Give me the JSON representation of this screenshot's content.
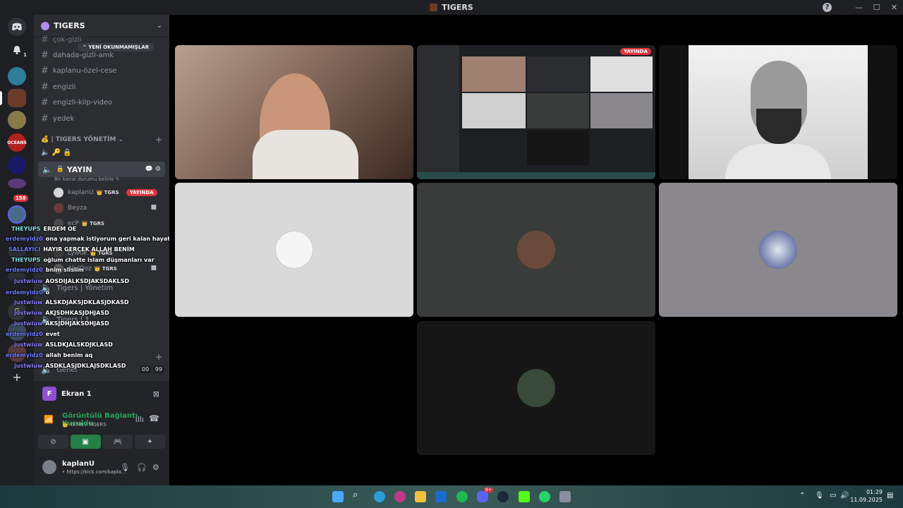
{
  "window": {
    "title": "TIGERS",
    "help_label": "?",
    "minimize": "—",
    "maximize": "☐",
    "close": "✕"
  },
  "servers": {
    "items": [
      {
        "name": "discord-home",
        "color": "#5865f2"
      },
      {
        "name": "notifications",
        "color": "#313338"
      },
      {
        "name": "server-1",
        "color": "#2e7d9a"
      },
      {
        "name": "server-tigers",
        "color": "#6b3a2a"
      },
      {
        "name": "server-3",
        "color": "#8a7a4a"
      },
      {
        "name": "server-oceans",
        "color": "#b32020"
      },
      {
        "name": "server-5",
        "color": "#1a1a6a"
      },
      {
        "name": "server-6",
        "color": "#5a3a7a"
      },
      {
        "name": "server-7",
        "color": "#4a6a8a"
      }
    ],
    "badge_count": "158",
    "notif_count": "1"
  },
  "sidebar": {
    "guild_name": "TIGERS",
    "unread_pill": "YENİ OKUNMAMIŞLAR",
    "channels": [
      "çok-gizli",
      "dahada-gizli-amk",
      "kaplanu-özel-cese",
      "engizli",
      "engizli-kilp-video",
      "yedek"
    ],
    "category": "| TIGERS YÖNETİM",
    "voice_channel": "YAYIN",
    "voice_sub": "Bir kanal durumu belirle",
    "voice_users": [
      {
        "name": "kaplanU",
        "tag": "TGRS",
        "live": "YAYINDA"
      },
      {
        "name": "Beyza",
        "tag": "",
        "live": ""
      },
      {
        "name": "ecP",
        "tag": "TGRS",
        "live": ""
      },
      {
        "name": "Lywok",
        "tag": "TGRS",
        "live": ""
      },
      {
        "name": "AkılOoz",
        "tag": "TGRS",
        "live": ""
      }
    ],
    "lower_items": [
      "Tigers | Yönetim",
      "Tigers | 1",
      "Genel"
    ],
    "lower_counts": [
      "00",
      "99"
    ]
  },
  "chat_overlay": [
    {
      "user": "THEYUPS",
      "color": "#7ee0e0",
      "msg": "ERDEM OE"
    },
    {
      "user": "erdemyidz0",
      "color": "#6a7cff",
      "msg": "ona yapmak istiyorum geri kalan hayatımda"
    },
    {
      "user": "SALLAYICI",
      "color": "#6a7cff",
      "msg": "HAYIR GERÇEK ALLAH BENİM"
    },
    {
      "user": "THEYUPS",
      "color": "#7ee0e0",
      "msg": "oğlum chatte islam düşmanları var"
    },
    {
      "user": "erdemyidz0",
      "color": "#6a7cff",
      "msg": "bnim slisiim"
    },
    {
      "user": "justwiuw",
      "color": "#8a7cff",
      "msg": "AOSDIJALKSDJAKSDAKLSD"
    },
    {
      "user": "erdemyidz0",
      "color": "#6a7cff",
      "msg": "o"
    },
    {
      "user": "justwiuw",
      "color": "#8a7cff",
      "msg": "ALSKDJAKSJDKLASJDKASD"
    },
    {
      "user": "justwiuw",
      "color": "#8a7cff",
      "msg": "AKJSDHKASJDHJASD"
    },
    {
      "user": "justwiuw",
      "color": "#8a7cff",
      "msg": "AKSJDHJAKSDHJASD"
    },
    {
      "user": "erdemyidz0",
      "color": "#6a7cff",
      "msg": "evet"
    },
    {
      "user": "justwiuw",
      "color": "#8a7cff",
      "msg": "ASLDKJALSKDJKLASD"
    },
    {
      "user": "erdemyidz0",
      "color": "#6a7cff",
      "msg": "allah benim aq"
    },
    {
      "user": "justwiuw",
      "color": "#8a7cff",
      "msg": "ASDKLASJDKLAJSDKLASD"
    }
  ],
  "user_panel": {
    "stream_label": "Ekran 1",
    "stream_initial": "F",
    "connection_status": "Görüntülü Bağlantı Kuruldu",
    "connection_sub": "YAYIN / TIGERS",
    "username": "kaplanU",
    "user_status": "• https://kick.com/kapla..."
  },
  "stage": {
    "live_badge": "YAYINDA",
    "tile_colors": [
      "#d9d9d9",
      "#3a3c3b",
      "#8a888c",
      "#161616"
    ]
  },
  "taskbar": {
    "time": "01:29",
    "date": "11.09.2025",
    "discord_badge": "9+"
  }
}
